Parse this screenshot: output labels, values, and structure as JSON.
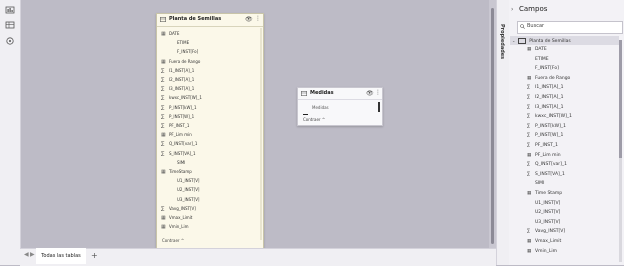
{
  "left_toolbar": {
    "items": [
      "report-view-icon",
      "table-view-icon",
      "model-view-icon"
    ]
  },
  "table_card": {
    "title": "Planta de Semillas",
    "fields": [
      {
        "name": "DATE",
        "icon": "table"
      },
      {
        "name": "ETIME",
        "icon": "none",
        "indent": true
      },
      {
        "name": "F_INST[Fo]",
        "icon": "none",
        "indent": true
      },
      {
        "name": "Fuera de Rango",
        "icon": "table"
      },
      {
        "name": "I1_INST[A]_1",
        "icon": "sigma"
      },
      {
        "name": "I2_INST[A]_1",
        "icon": "sigma"
      },
      {
        "name": "I3_INST[A]_1",
        "icon": "sigma"
      },
      {
        "name": "kwxc_INST[W]_1",
        "icon": "sigma"
      },
      {
        "name": "P_INST[kW]_1",
        "icon": "sigma"
      },
      {
        "name": "P_INST[W]_1",
        "icon": "sigma"
      },
      {
        "name": "PF_INST_1",
        "icon": "sigma"
      },
      {
        "name": "PF_Lim min",
        "icon": "table"
      },
      {
        "name": "Q_INST[var]_1",
        "icon": "sigma"
      },
      {
        "name": "S_INST[VA]_1",
        "icon": "sigma"
      },
      {
        "name": "SIMI",
        "icon": "none",
        "indent": true
      },
      {
        "name": "TimeStamp",
        "icon": "table"
      },
      {
        "name": "U1_INST[V]",
        "icon": "none",
        "indent": true
      },
      {
        "name": "U2_INST[V]",
        "icon": "none",
        "indent": true
      },
      {
        "name": "U3_INST[V]",
        "icon": "none",
        "indent": true
      },
      {
        "name": "Vavg_INST[V]",
        "icon": "sigma"
      },
      {
        "name": "Vmax_Limit",
        "icon": "table"
      },
      {
        "name": "Vmin_Lim",
        "icon": "table"
      }
    ],
    "collapse_label": "Contraer ^"
  },
  "measures_card": {
    "title": "Medidas",
    "item": "Medidas",
    "collapse_label": "Contraer ^"
  },
  "bottom_tabs": {
    "active": "Todas las tablas",
    "add": "+"
  },
  "properties_panel": {
    "label": "Propiedades"
  },
  "fields_panel": {
    "title": "Campos",
    "search_placeholder": "Buscar",
    "table_name": "Planta de Semillas",
    "fields": [
      {
        "name": "DATE",
        "icon": "table"
      },
      {
        "name": "ETIME",
        "icon": "none"
      },
      {
        "name": "F_INST[Fo]",
        "icon": "none"
      },
      {
        "name": "Fuera de Rango",
        "icon": "table"
      },
      {
        "name": "I1_INST[A]_1",
        "icon": "sigma"
      },
      {
        "name": "I2_INST[A]_1",
        "icon": "sigma"
      },
      {
        "name": "I3_INST[A]_1",
        "icon": "sigma"
      },
      {
        "name": "kwxc_INST[W]_1",
        "icon": "sigma"
      },
      {
        "name": "P_INST[kW]_1",
        "icon": "sigma"
      },
      {
        "name": "P_INST[W]_1",
        "icon": "sigma"
      },
      {
        "name": "PF_INST_1",
        "icon": "sigma"
      },
      {
        "name": "PF_Lim min",
        "icon": "table"
      },
      {
        "name": "Q_INST[var]_1",
        "icon": "sigma"
      },
      {
        "name": "S_INST[VA]_1",
        "icon": "sigma"
      },
      {
        "name": "SIMI",
        "icon": "none"
      },
      {
        "name": "Time Stamp",
        "icon": "table"
      },
      {
        "name": "U1_INST[V]",
        "icon": "none"
      },
      {
        "name": "U2_INST[V]",
        "icon": "none"
      },
      {
        "name": "U3_INST[V]",
        "icon": "none"
      },
      {
        "name": "Vavg_INST[V]",
        "icon": "sigma"
      },
      {
        "name": "Vmax_Limit",
        "icon": "table"
      },
      {
        "name": "Vmin_Lim",
        "icon": "table"
      }
    ]
  }
}
